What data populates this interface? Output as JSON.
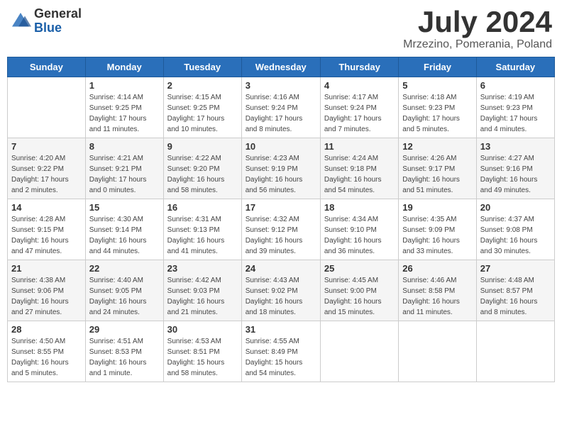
{
  "logo": {
    "general": "General",
    "blue": "Blue"
  },
  "title": "July 2024",
  "location": "Mrzezino, Pomerania, Poland",
  "days_of_week": [
    "Sunday",
    "Monday",
    "Tuesday",
    "Wednesday",
    "Thursday",
    "Friday",
    "Saturday"
  ],
  "weeks": [
    [
      {
        "day": "",
        "info": ""
      },
      {
        "day": "1",
        "info": "Sunrise: 4:14 AM\nSunset: 9:25 PM\nDaylight: 17 hours\nand 11 minutes."
      },
      {
        "day": "2",
        "info": "Sunrise: 4:15 AM\nSunset: 9:25 PM\nDaylight: 17 hours\nand 10 minutes."
      },
      {
        "day": "3",
        "info": "Sunrise: 4:16 AM\nSunset: 9:24 PM\nDaylight: 17 hours\nand 8 minutes."
      },
      {
        "day": "4",
        "info": "Sunrise: 4:17 AM\nSunset: 9:24 PM\nDaylight: 17 hours\nand 7 minutes."
      },
      {
        "day": "5",
        "info": "Sunrise: 4:18 AM\nSunset: 9:23 PM\nDaylight: 17 hours\nand 5 minutes."
      },
      {
        "day": "6",
        "info": "Sunrise: 4:19 AM\nSunset: 9:23 PM\nDaylight: 17 hours\nand 4 minutes."
      }
    ],
    [
      {
        "day": "7",
        "info": "Sunrise: 4:20 AM\nSunset: 9:22 PM\nDaylight: 17 hours\nand 2 minutes."
      },
      {
        "day": "8",
        "info": "Sunrise: 4:21 AM\nSunset: 9:21 PM\nDaylight: 17 hours\nand 0 minutes."
      },
      {
        "day": "9",
        "info": "Sunrise: 4:22 AM\nSunset: 9:20 PM\nDaylight: 16 hours\nand 58 minutes."
      },
      {
        "day": "10",
        "info": "Sunrise: 4:23 AM\nSunset: 9:19 PM\nDaylight: 16 hours\nand 56 minutes."
      },
      {
        "day": "11",
        "info": "Sunrise: 4:24 AM\nSunset: 9:18 PM\nDaylight: 16 hours\nand 54 minutes."
      },
      {
        "day": "12",
        "info": "Sunrise: 4:26 AM\nSunset: 9:17 PM\nDaylight: 16 hours\nand 51 minutes."
      },
      {
        "day": "13",
        "info": "Sunrise: 4:27 AM\nSunset: 9:16 PM\nDaylight: 16 hours\nand 49 minutes."
      }
    ],
    [
      {
        "day": "14",
        "info": "Sunrise: 4:28 AM\nSunset: 9:15 PM\nDaylight: 16 hours\nand 47 minutes."
      },
      {
        "day": "15",
        "info": "Sunrise: 4:30 AM\nSunset: 9:14 PM\nDaylight: 16 hours\nand 44 minutes."
      },
      {
        "day": "16",
        "info": "Sunrise: 4:31 AM\nSunset: 9:13 PM\nDaylight: 16 hours\nand 41 minutes."
      },
      {
        "day": "17",
        "info": "Sunrise: 4:32 AM\nSunset: 9:12 PM\nDaylight: 16 hours\nand 39 minutes."
      },
      {
        "day": "18",
        "info": "Sunrise: 4:34 AM\nSunset: 9:10 PM\nDaylight: 16 hours\nand 36 minutes."
      },
      {
        "day": "19",
        "info": "Sunrise: 4:35 AM\nSunset: 9:09 PM\nDaylight: 16 hours\nand 33 minutes."
      },
      {
        "day": "20",
        "info": "Sunrise: 4:37 AM\nSunset: 9:08 PM\nDaylight: 16 hours\nand 30 minutes."
      }
    ],
    [
      {
        "day": "21",
        "info": "Sunrise: 4:38 AM\nSunset: 9:06 PM\nDaylight: 16 hours\nand 27 minutes."
      },
      {
        "day": "22",
        "info": "Sunrise: 4:40 AM\nSunset: 9:05 PM\nDaylight: 16 hours\nand 24 minutes."
      },
      {
        "day": "23",
        "info": "Sunrise: 4:42 AM\nSunset: 9:03 PM\nDaylight: 16 hours\nand 21 minutes."
      },
      {
        "day": "24",
        "info": "Sunrise: 4:43 AM\nSunset: 9:02 PM\nDaylight: 16 hours\nand 18 minutes."
      },
      {
        "day": "25",
        "info": "Sunrise: 4:45 AM\nSunset: 9:00 PM\nDaylight: 16 hours\nand 15 minutes."
      },
      {
        "day": "26",
        "info": "Sunrise: 4:46 AM\nSunset: 8:58 PM\nDaylight: 16 hours\nand 11 minutes."
      },
      {
        "day": "27",
        "info": "Sunrise: 4:48 AM\nSunset: 8:57 PM\nDaylight: 16 hours\nand 8 minutes."
      }
    ],
    [
      {
        "day": "28",
        "info": "Sunrise: 4:50 AM\nSunset: 8:55 PM\nDaylight: 16 hours\nand 5 minutes."
      },
      {
        "day": "29",
        "info": "Sunrise: 4:51 AM\nSunset: 8:53 PM\nDaylight: 16 hours\nand 1 minute."
      },
      {
        "day": "30",
        "info": "Sunrise: 4:53 AM\nSunset: 8:51 PM\nDaylight: 15 hours\nand 58 minutes."
      },
      {
        "day": "31",
        "info": "Sunrise: 4:55 AM\nSunset: 8:49 PM\nDaylight: 15 hours\nand 54 minutes."
      },
      {
        "day": "",
        "info": ""
      },
      {
        "day": "",
        "info": ""
      },
      {
        "day": "",
        "info": ""
      }
    ]
  ]
}
